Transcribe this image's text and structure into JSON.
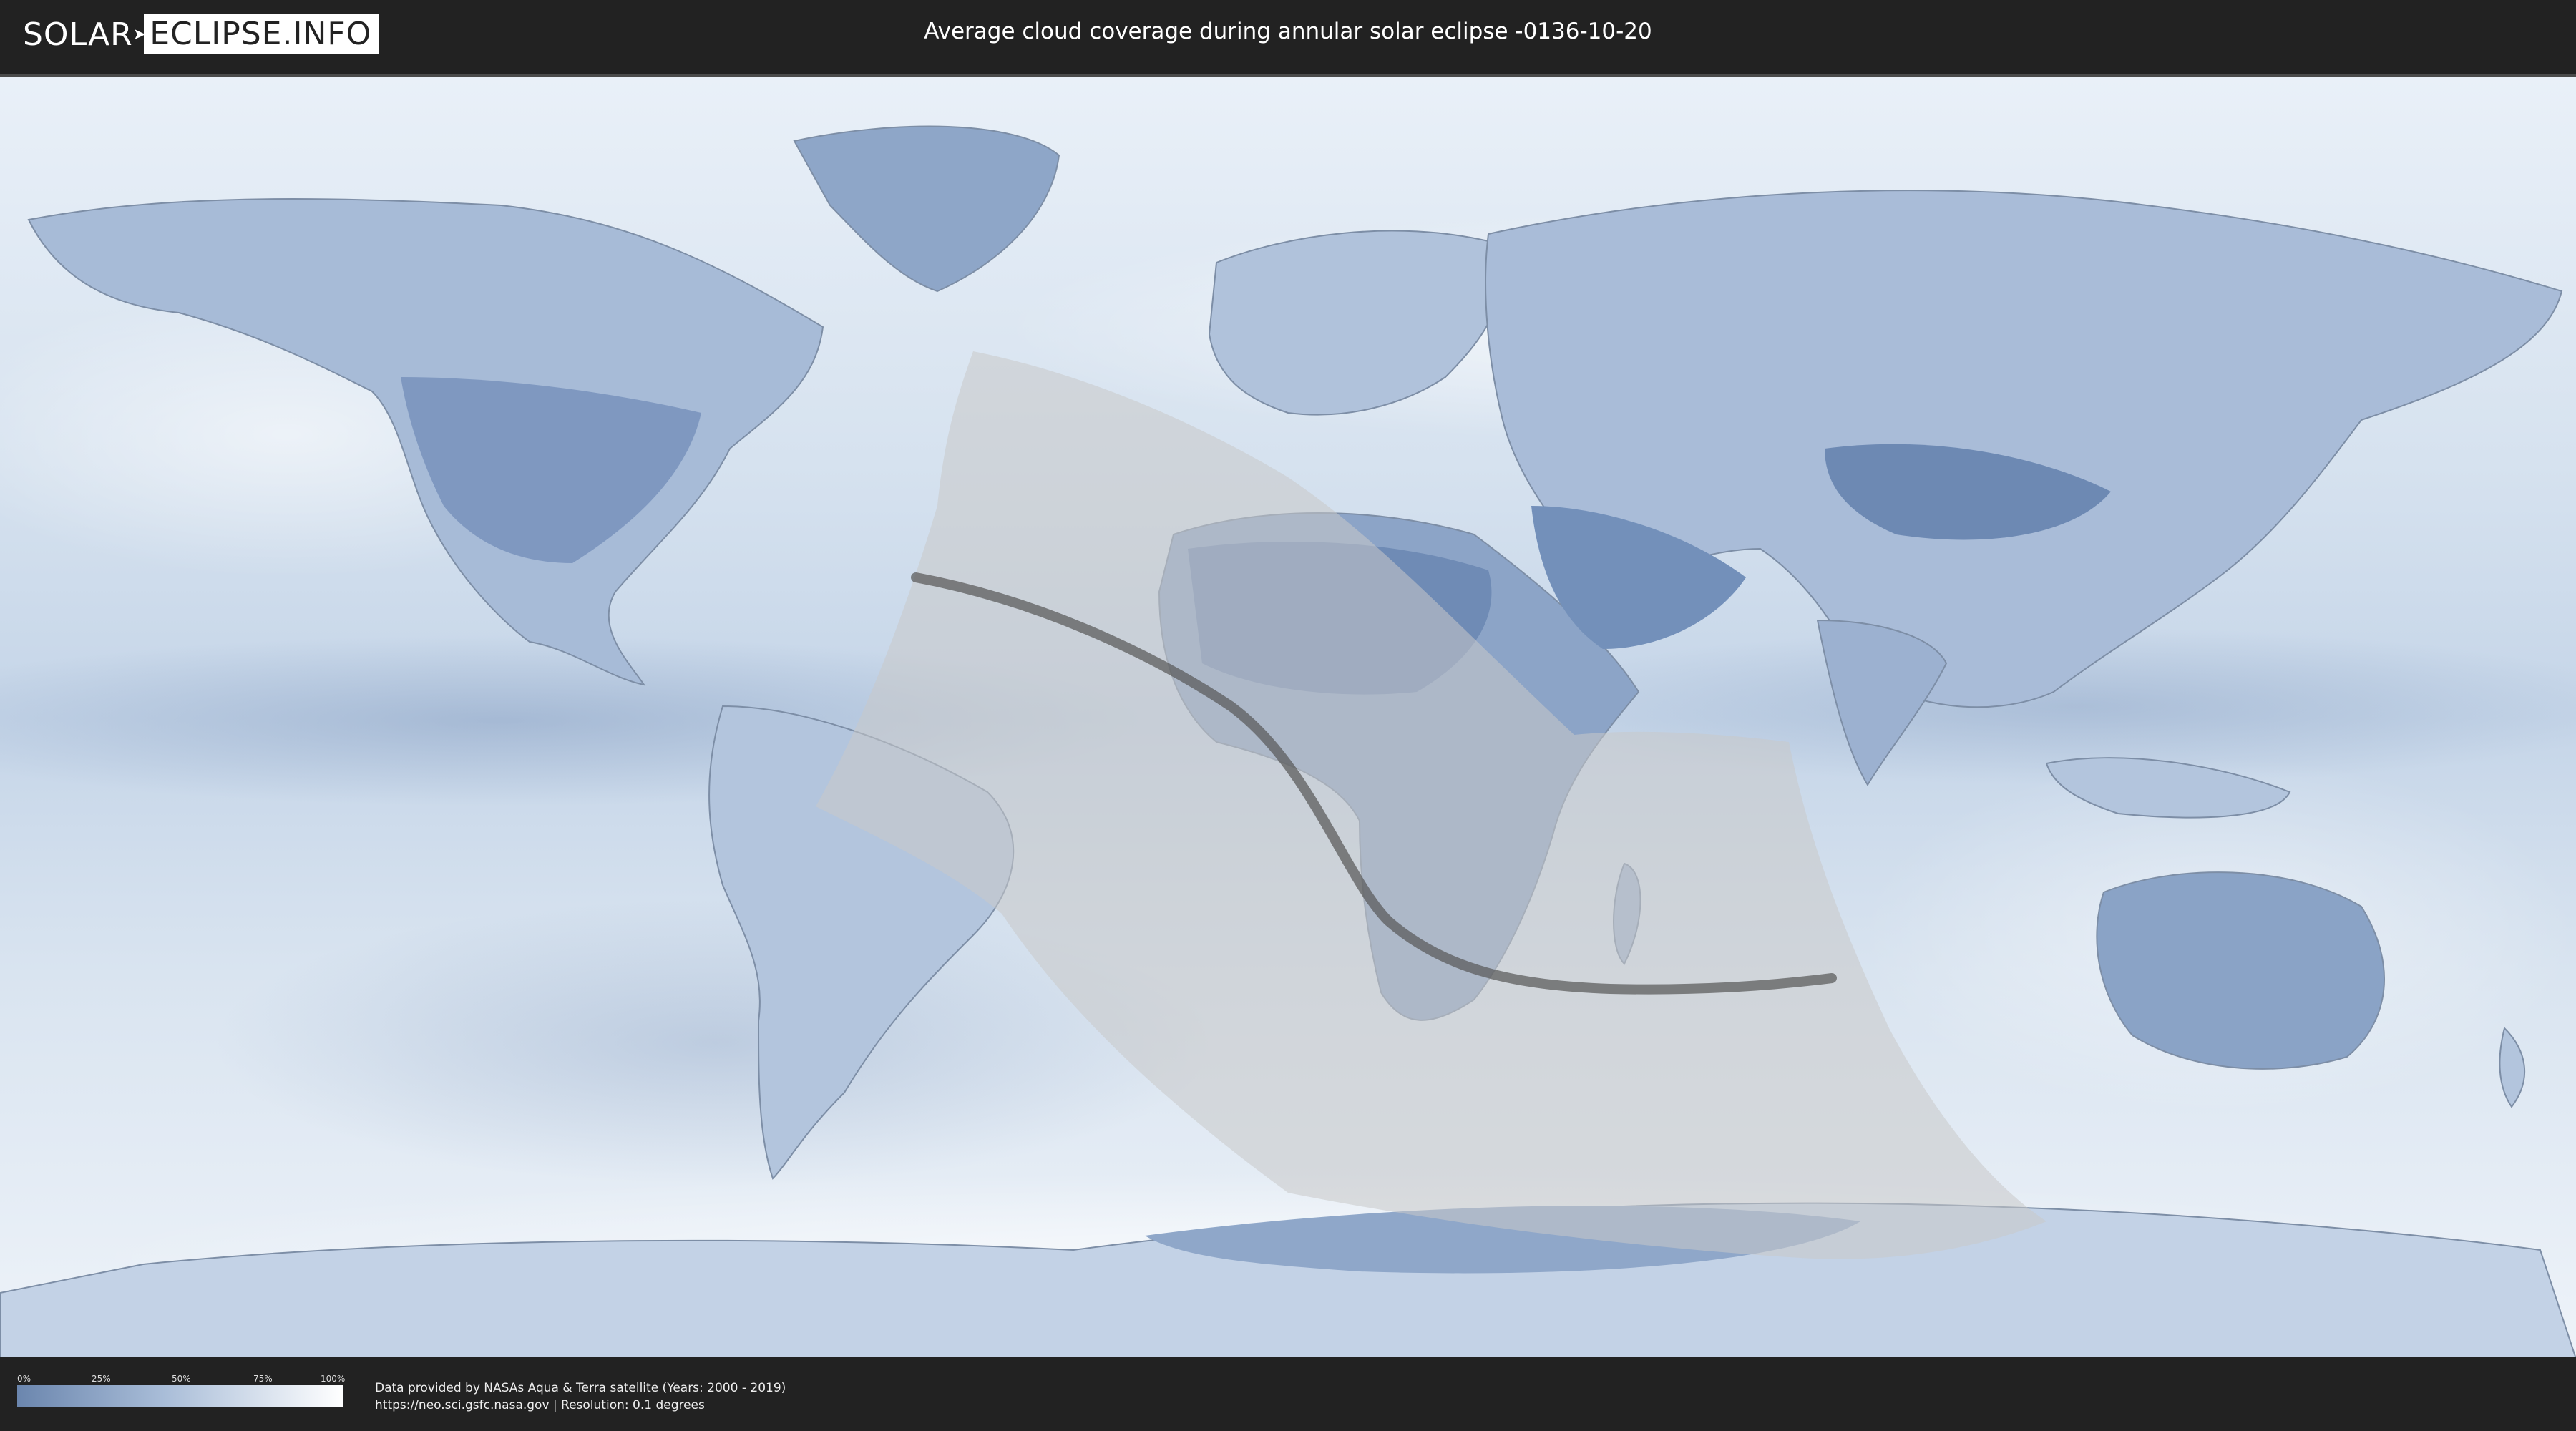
{
  "header": {
    "logo_left": "SOLAR",
    "logo_right": "ECLIPSE.INFO",
    "title": "Average cloud coverage during annular solar eclipse -0136-10-20"
  },
  "map": {
    "projection": "equirectangular world map",
    "base_layer": "average cloud coverage",
    "colors": {
      "clear_sky": "#6b86ae",
      "full_cloud": "#ffffff",
      "eclipse_zone": "#c8c8c8",
      "central_line": "#555555",
      "borders": "#7d8ea6"
    },
    "eclipse_overlay": {
      "type": "annular",
      "date": "-0136-10-20"
    }
  },
  "legend": {
    "ticks": [
      "0%",
      "25%",
      "50%",
      "75%",
      "100%"
    ],
    "gradient_start": "#6b86ae",
    "gradient_end": "#ffffff"
  },
  "footer": {
    "credit_line1": "Data provided by NASAs Aqua & Terra satellite (Years: 2000 - 2019)",
    "credit_line2": "https://neo.sci.gsfc.nasa.gov | Resolution: 0.1 degrees"
  }
}
